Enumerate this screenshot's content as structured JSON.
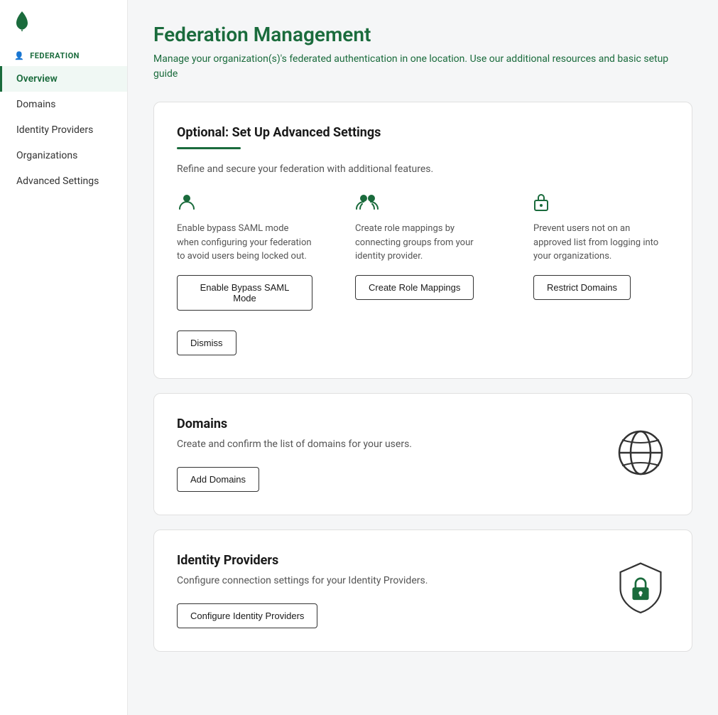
{
  "app": {
    "logo_alt": "MongoDB Leaf"
  },
  "sidebar": {
    "section_label": "FEDERATION",
    "section_icon": "person-icon",
    "items": [
      {
        "id": "overview",
        "label": "Overview",
        "active": true
      },
      {
        "id": "domains",
        "label": "Domains",
        "active": false
      },
      {
        "id": "identity-providers",
        "label": "Identity Providers",
        "active": false
      },
      {
        "id": "organizations",
        "label": "Organizations",
        "active": false
      },
      {
        "id": "advanced-settings",
        "label": "Advanced Settings",
        "active": false
      }
    ]
  },
  "main": {
    "title": "Federation Management",
    "subtitle_start": "Manage your organization(s)'s federated authentication ",
    "subtitle_link": "in",
    "subtitle_end": " one location. Use our additional resources and basic setup guide",
    "cards": {
      "advanced": {
        "title": "Optional: Set Up Advanced Settings",
        "description": "Refine and secure your federation with additional features.",
        "features": [
          {
            "id": "bypass-saml",
            "icon": "person-icon",
            "text": "Enable bypass SAML mode when configuring your federation to avoid users being locked out.",
            "button_label": "Enable Bypass SAML Mode"
          },
          {
            "id": "role-mappings",
            "icon": "group-icon",
            "text": "Create role mappings by connecting groups from your identity provider.",
            "button_label": "Create Role Mappings"
          },
          {
            "id": "restrict-domains",
            "icon": "lock-icon",
            "text": "Prevent users not on an approved list from logging into your organizations.",
            "button_label": "Restrict Domains"
          }
        ],
        "dismiss_label": "Dismiss"
      },
      "domains": {
        "title": "Domains",
        "description": "Create and confirm the list of domains for your users.",
        "button_label": "Add Domains"
      },
      "identity_providers": {
        "title": "Identity Providers",
        "description": "Configure connection settings for your Identity Providers.",
        "button_label": "Configure Identity Providers"
      }
    }
  },
  "colors": {
    "green": "#1a6b3c",
    "green_light": "#2d7a4f"
  }
}
